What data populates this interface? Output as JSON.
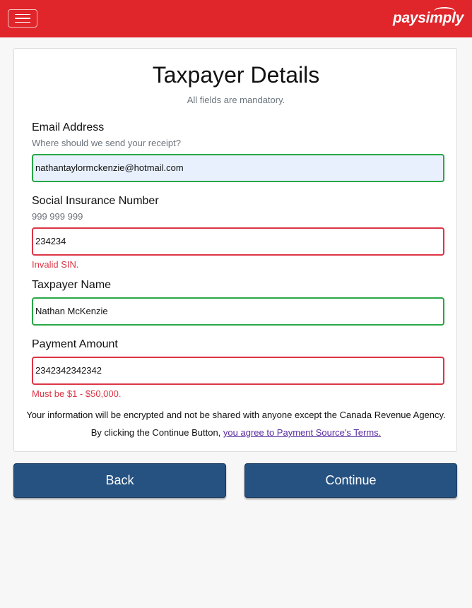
{
  "header": {
    "menu_icon": "hamburger-menu-icon",
    "logo_text": "paysimply",
    "brand_color": "#e0252b"
  },
  "form": {
    "title": "Taxpayer Details",
    "subtitle": "All fields are mandatory.",
    "email": {
      "label": "Email Address",
      "hint": "Where should we send your receipt?",
      "value": "nathantaylormckenzie@hotmail.com",
      "status": "valid"
    },
    "sin": {
      "label": "Social Insurance Number",
      "hint": "999 999 999",
      "value": "234234",
      "status": "invalid",
      "error": "Invalid SIN."
    },
    "name": {
      "label": "Taxpayer Name",
      "value": "Nathan McKenzie",
      "status": "valid"
    },
    "amount": {
      "label": "Payment Amount",
      "value": "2342342342342",
      "status": "invalid",
      "error": "Must be $1 - $50,000."
    },
    "privacy_notice": "Your information will be encrypted and not be shared with anyone except the Canada Revenue Agency.",
    "terms_prefix": "By clicking the Continue Button, ",
    "terms_link": "you agree to Payment Source's Terms."
  },
  "actions": {
    "back_label": "Back",
    "continue_label": "Continue",
    "button_color": "#265281"
  },
  "colors": {
    "valid": "#28a745",
    "invalid": "#dc3545",
    "link": "#5a2ca0"
  }
}
